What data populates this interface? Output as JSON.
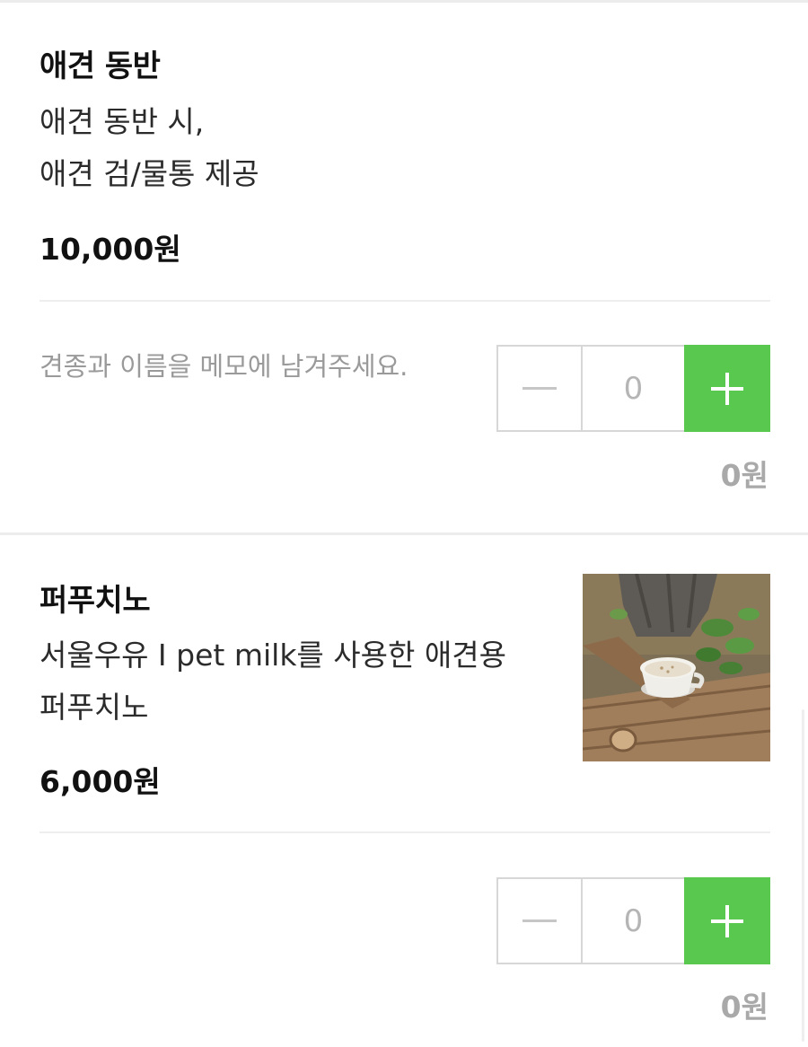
{
  "items": [
    {
      "title": "애견 동반",
      "desc_line1": "애견 동반 시,",
      "desc_line2": "애견 검/물통 제공",
      "price": "10,000원",
      "memo": "견종과 이름을 메모에 남겨주세요.",
      "quantity": "0",
      "subtotal": "0원"
    },
    {
      "title": "퍼푸치노",
      "desc_line1": "서울우유 I pet milk를 사용한 애견용",
      "desc_line2": "퍼푸치노",
      "price": "6,000원",
      "quantity": "0",
      "subtotal": "0원",
      "image_alt": "cup-on-log-photo"
    }
  ],
  "colors": {
    "accent": "#58c84f",
    "muted_text": "#9a9a9a",
    "border": "#d7d7d7"
  }
}
